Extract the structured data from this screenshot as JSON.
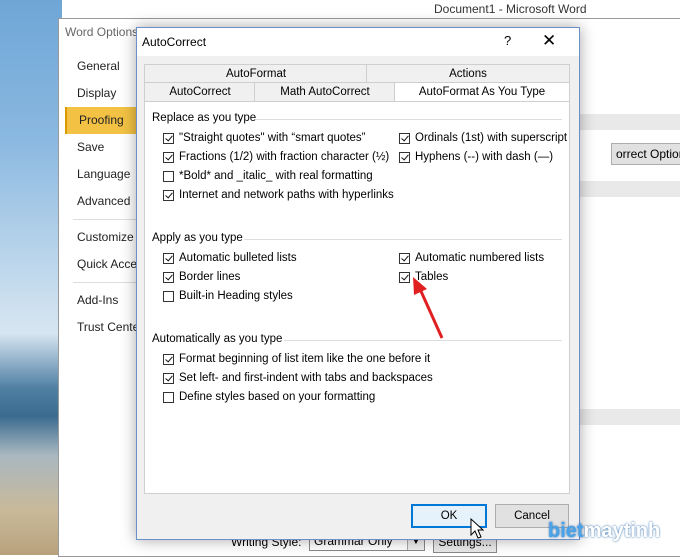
{
  "word": {
    "window_title": "Document1 - Microsoft Word",
    "options_title": "Word Options",
    "nav": [
      "General",
      "Display",
      "Proofing",
      "Save",
      "Language",
      "Advanced",
      "Customize R",
      "Quick Acces",
      "Add-Ins",
      "Trust Center"
    ],
    "active_nav": "Proofing",
    "autocorrect_options_button": "orrect Options...",
    "writing_style_label": "Writing Style:",
    "writing_style_value": "Grammar Only",
    "settings_button": "Settings..."
  },
  "dialog": {
    "title": "AutoCorrect",
    "help": "?",
    "close": "✕",
    "tabs_row1": [
      "AutoFormat",
      "Actions"
    ],
    "tabs_row2": [
      "AutoCorrect",
      "Math AutoCorrect",
      "AutoFormat As You Type"
    ],
    "selected_tab": "AutoFormat As You Type",
    "sections": {
      "replace": {
        "title": "Replace as you type",
        "left": [
          {
            "label": "\"Straight quotes\" with “smart quotes”",
            "checked": true
          },
          {
            "label": "Fractions (1/2) with fraction character (½)",
            "checked": true
          },
          {
            "label": "*Bold* and _italic_ with real formatting",
            "checked": false
          },
          {
            "label": "Internet and network paths with hyperlinks",
            "checked": true
          }
        ],
        "right": [
          {
            "label": "Ordinals (1st) with superscript",
            "checked": true
          },
          {
            "label": "Hyphens (--) with dash (—)",
            "checked": true
          }
        ]
      },
      "apply": {
        "title": "Apply as you type",
        "left": [
          {
            "label": "Automatic bulleted lists",
            "checked": true
          },
          {
            "label": "Border lines",
            "checked": true
          },
          {
            "label": "Built-in Heading styles",
            "checked": false
          }
        ],
        "right": [
          {
            "label": "Automatic numbered lists",
            "checked": true
          },
          {
            "label": "Tables",
            "checked": true
          }
        ]
      },
      "auto": {
        "title": "Automatically as you type",
        "items": [
          {
            "label": "Format beginning of list item like the one before it",
            "checked": true
          },
          {
            "label": "Set left- and first-indent with tabs and backspaces",
            "checked": true
          },
          {
            "label": "Define styles based on your formatting",
            "checked": false
          }
        ]
      }
    },
    "ok": "OK",
    "cancel": "Cancel"
  },
  "watermark": {
    "part1": "biet",
    "part2": "maytinh"
  },
  "colors": {
    "accent": "#0078d7",
    "nav_active": "#f3c244",
    "arrow": "#e02020"
  }
}
